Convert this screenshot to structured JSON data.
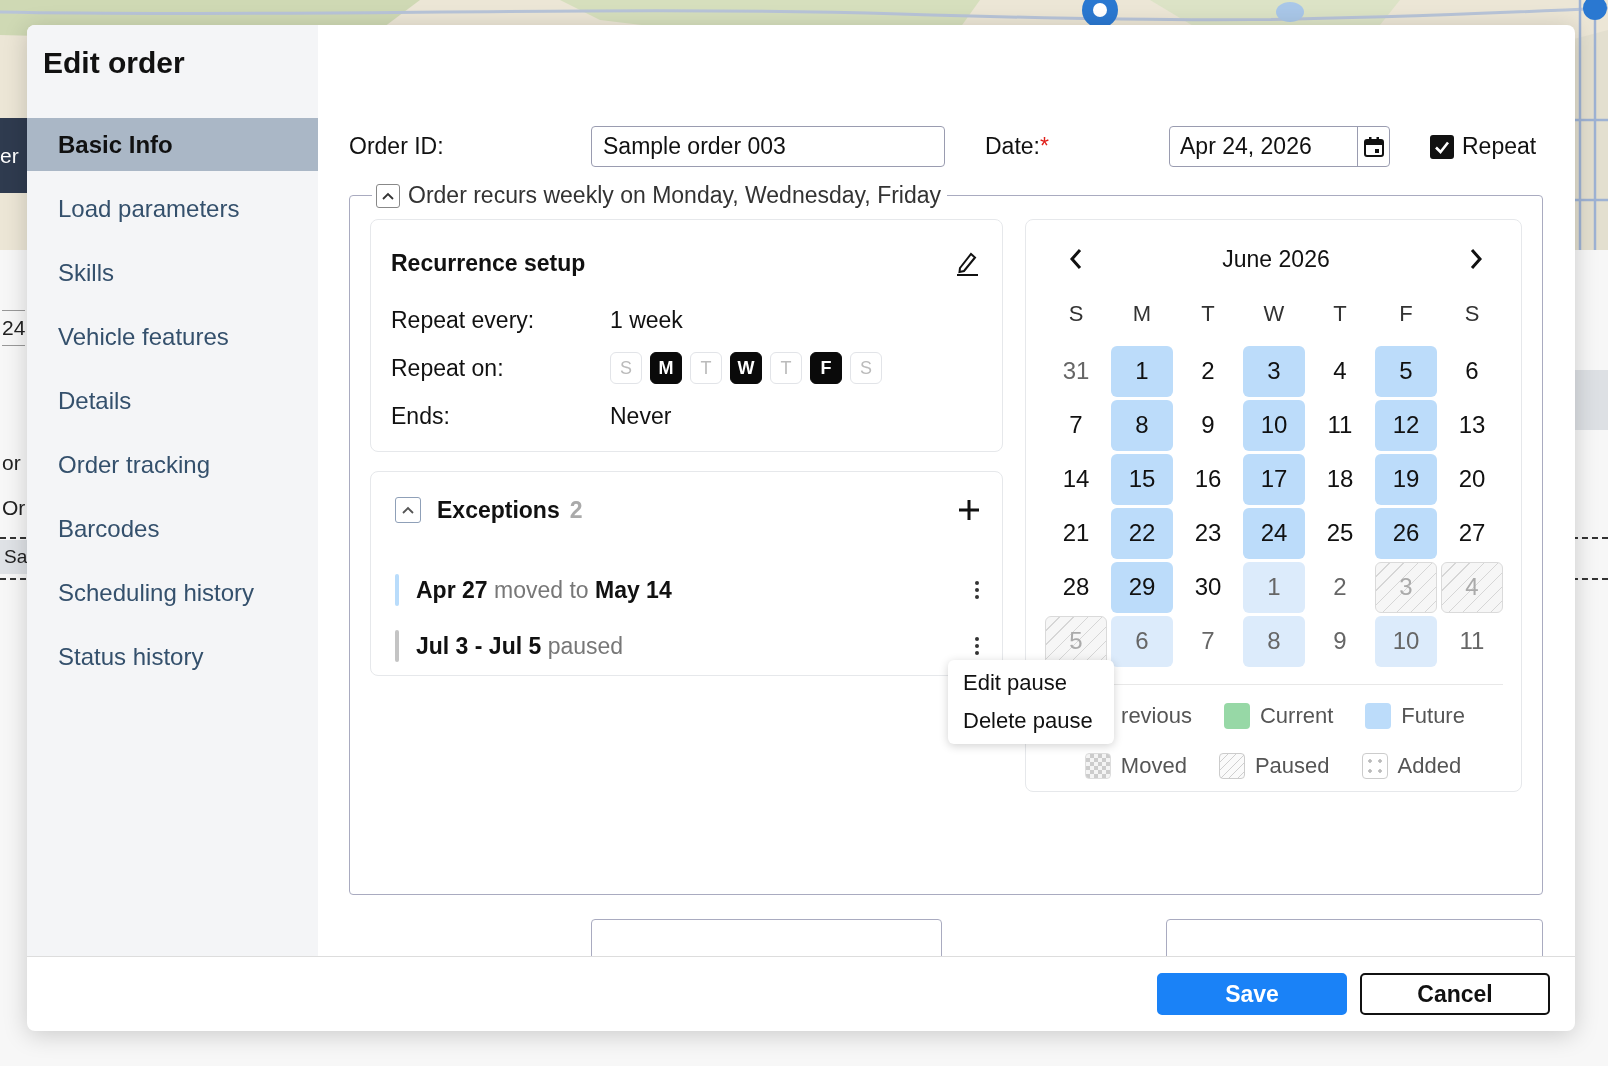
{
  "backdrop": {
    "fragments": [
      {
        "kind": "dark",
        "text": "er"
      },
      {
        "kind": "field",
        "text": "24"
      },
      {
        "kind": "plain",
        "text": "or"
      },
      {
        "kind": "plain",
        "text": "Or"
      },
      {
        "kind": "row",
        "text": "Sa"
      }
    ]
  },
  "dialog": {
    "title": "Edit order"
  },
  "sidebar": {
    "items": [
      {
        "label": "Basic Info",
        "selected": true
      },
      {
        "label": "Load parameters",
        "selected": false
      },
      {
        "label": "Skills",
        "selected": false
      },
      {
        "label": "Vehicle features",
        "selected": false
      },
      {
        "label": "Details",
        "selected": false
      },
      {
        "label": "Order tracking",
        "selected": false
      },
      {
        "label": "Barcodes",
        "selected": false
      },
      {
        "label": "Scheduling history",
        "selected": false
      },
      {
        "label": "Status history",
        "selected": false
      }
    ]
  },
  "order_id": {
    "label": "Order ID:",
    "value": "Sample order 003"
  },
  "date": {
    "label": "Date:",
    "required_mark": "*",
    "value": "Apr 24, 2026"
  },
  "repeat": {
    "label": "Repeat",
    "checked": true
  },
  "recurrence": {
    "summary": "Order recurs weekly on Monday, Wednesday, Friday",
    "expanded": true,
    "setup": {
      "title": "Recurrence setup",
      "repeat_every_label": "Repeat every:",
      "repeat_every": "1 week",
      "repeat_on_label": "Repeat on:",
      "ends_label": "Ends:",
      "ends": "Never",
      "days": [
        {
          "label": "S",
          "selected": false
        },
        {
          "label": "M",
          "selected": true
        },
        {
          "label": "T",
          "selected": false
        },
        {
          "label": "W",
          "selected": true
        },
        {
          "label": "T",
          "selected": false
        },
        {
          "label": "F",
          "selected": true
        },
        {
          "label": "S",
          "selected": false
        }
      ]
    },
    "exceptions": {
      "title": "Exceptions",
      "count": "2",
      "expanded": true,
      "items": [
        {
          "text": "**Apr 27** moved to **May 14**",
          "color": "#b9dcfb"
        },
        {
          "text": "**Jul 3 - Jul 5** paused",
          "color": "#c4c4c4"
        }
      ]
    },
    "menu": {
      "items": [
        "Edit pause",
        "Delete pause"
      ]
    },
    "calendar": {
      "month": "June 2026",
      "weekdays": [
        "S",
        "M",
        "T",
        "W",
        "T",
        "F",
        "S"
      ],
      "cells": [
        {
          "day": "31",
          "kind": "none",
          "outside": true
        },
        {
          "day": "1",
          "kind": "future",
          "outside": false
        },
        {
          "day": "2",
          "kind": "none",
          "outside": false
        },
        {
          "day": "3",
          "kind": "future",
          "outside": false
        },
        {
          "day": "4",
          "kind": "none",
          "outside": false
        },
        {
          "day": "5",
          "kind": "future",
          "outside": false
        },
        {
          "day": "6",
          "kind": "none",
          "outside": false
        },
        {
          "day": "7",
          "kind": "none",
          "outside": false
        },
        {
          "day": "8",
          "kind": "future",
          "outside": false
        },
        {
          "day": "9",
          "kind": "none",
          "outside": false
        },
        {
          "day": "10",
          "kind": "future",
          "outside": false
        },
        {
          "day": "11",
          "kind": "none",
          "outside": false
        },
        {
          "day": "12",
          "kind": "future",
          "outside": false
        },
        {
          "day": "13",
          "kind": "none",
          "outside": false
        },
        {
          "day": "14",
          "kind": "none",
          "outside": false
        },
        {
          "day": "15",
          "kind": "future",
          "outside": false
        },
        {
          "day": "16",
          "kind": "none",
          "outside": false
        },
        {
          "day": "17",
          "kind": "future",
          "outside": false
        },
        {
          "day": "18",
          "kind": "none",
          "outside": false
        },
        {
          "day": "19",
          "kind": "future",
          "outside": false
        },
        {
          "day": "20",
          "kind": "none",
          "outside": false
        },
        {
          "day": "21",
          "kind": "none",
          "outside": false
        },
        {
          "day": "22",
          "kind": "future",
          "outside": false
        },
        {
          "day": "23",
          "kind": "none",
          "outside": false
        },
        {
          "day": "24",
          "kind": "future",
          "outside": false
        },
        {
          "day": "25",
          "kind": "none",
          "outside": false
        },
        {
          "day": "26",
          "kind": "future",
          "outside": false
        },
        {
          "day": "27",
          "kind": "none",
          "outside": false
        },
        {
          "day": "28",
          "kind": "none",
          "outside": false
        },
        {
          "day": "29",
          "kind": "future",
          "outside": false
        },
        {
          "day": "30",
          "kind": "none",
          "outside": false
        },
        {
          "day": "1",
          "kind": "future",
          "outside": true
        },
        {
          "day": "2",
          "kind": "none",
          "outside": true
        },
        {
          "day": "3",
          "kind": "paused",
          "outside": true
        },
        {
          "day": "4",
          "kind": "paused",
          "outside": true
        },
        {
          "day": "5",
          "kind": "paused",
          "outside": true
        },
        {
          "day": "6",
          "kind": "future",
          "outside": true
        },
        {
          "day": "7",
          "kind": "none",
          "outside": true
        },
        {
          "day": "8",
          "kind": "future",
          "outside": true
        },
        {
          "day": "9",
          "kind": "none",
          "outside": true
        },
        {
          "day": "10",
          "kind": "future",
          "outside": true
        },
        {
          "day": "11",
          "kind": "none",
          "outside": true
        }
      ],
      "legend": [
        [
          {
            "kind": "covered",
            "label": "revious"
          },
          {
            "kind": "current",
            "label": "Current"
          },
          {
            "kind": "future",
            "label": "Future"
          }
        ],
        [
          {
            "kind": "moved",
            "label": "Moved"
          },
          {
            "kind": "paused",
            "label": "Paused"
          },
          {
            "kind": "added",
            "label": "Added"
          }
        ]
      ]
    }
  },
  "buttons": [
    {
      "kind": "primary",
      "label": "Save"
    },
    {
      "kind": "secondary",
      "label": "Cancel"
    }
  ]
}
